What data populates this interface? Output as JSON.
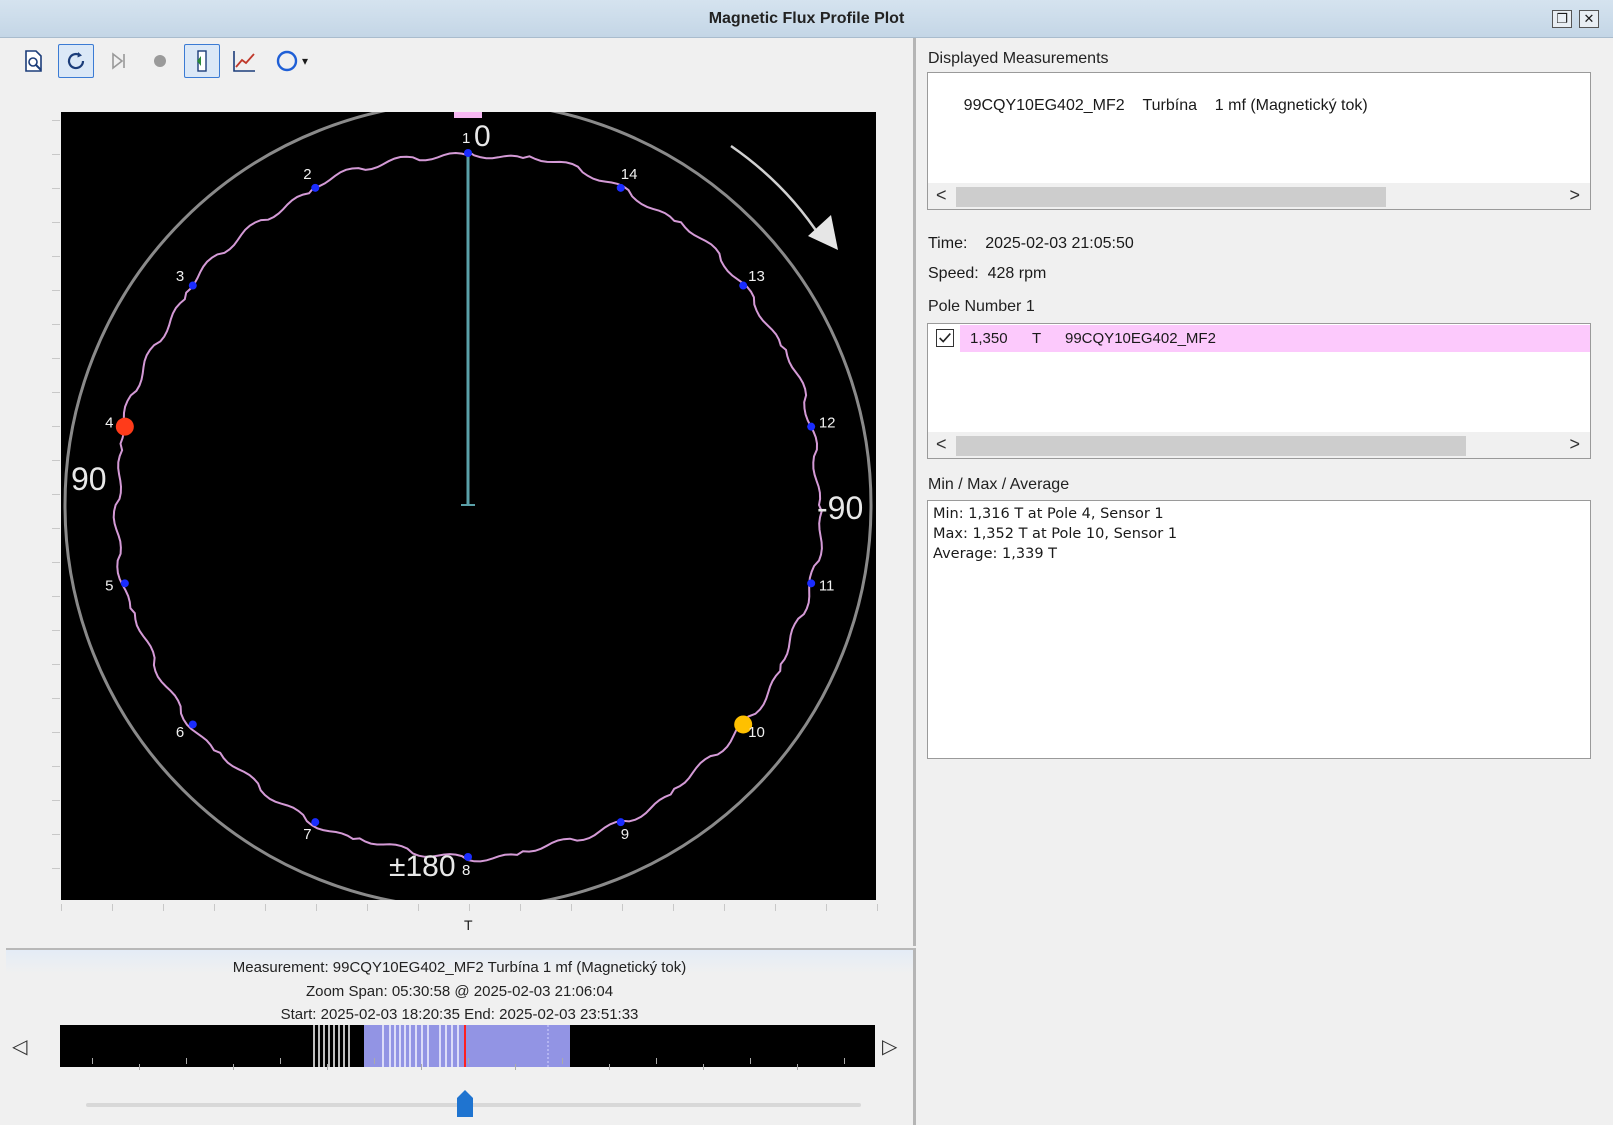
{
  "window": {
    "title": "Magnetic Flux Profile Plot",
    "restore_btn": "❐",
    "close_btn": "✕"
  },
  "toolbar": {
    "icons": [
      "print-preview-icon",
      "refresh-icon",
      "step-forward-icon",
      "record-icon",
      "sensor-view-icon",
      "trend-icon",
      "circle-plot-icon"
    ],
    "circle_dropdown": "▾"
  },
  "plot": {
    "angle_labels": {
      "top": "0",
      "left": "90",
      "right": "-90",
      "bottom": "±180"
    },
    "pole_labels": [
      "1",
      "2",
      "3",
      "4",
      "5",
      "6",
      "7",
      "8",
      "9",
      "10",
      "11",
      "12",
      "13",
      "14"
    ],
    "x_axis_unit": "T",
    "min_pole": "4",
    "max_pole": "10",
    "colors": {
      "profile": "#d49ad6",
      "min_marker": "#ff3b1a",
      "max_marker": "#ffc000",
      "pole_dot": "#1a2cff",
      "pointer": "#5aa0a8"
    }
  },
  "timeline": {
    "measurement_line": "Measurement: 99CQY10EG402_MF2  Turbína   1 mf (Magnetický tok)",
    "zoom_line": "Zoom Span: 05:30:58 @ 2025-02-03 21:06:04",
    "range_line": "Start:  2025-02-03 18:20:35 End:  2025-02-03 23:51:33",
    "left_arrow": "◁",
    "right_arrow": "▷"
  },
  "right": {
    "displayed_label": "Displayed Measurements",
    "displayed_rows": [
      {
        "tag": "99CQY10EG402_MF2",
        "group": "Turbína",
        "name": "1 mf (Magnetický tok)"
      }
    ],
    "time_label": "Time:",
    "time_value": "2025-02-03 21:05:50",
    "speed_label": "Speed:",
    "speed_value": "428 rpm",
    "pole_label": "Pole Number 1",
    "pole_row": {
      "value": "1,350",
      "unit": "T",
      "tag": "99CQY10EG402_MF2"
    },
    "stats_label": "Min / Max / Average",
    "stats": {
      "min": "Min: 1,316 T at Pole 4, Sensor 1",
      "max": "Max: 1,352 T at Pole 10, Sensor 1",
      "avg": "Average: 1,339 T"
    },
    "scroll_left": "<",
    "scroll_right": ">"
  }
}
